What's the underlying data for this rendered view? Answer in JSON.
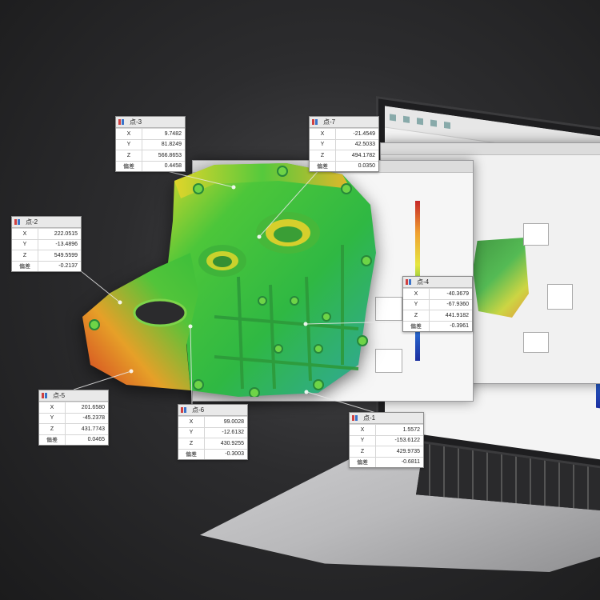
{
  "points": [
    {
      "name": "点-1",
      "x": "1.5572",
      "y": "-153.6122",
      "z": "429.9735",
      "dev": "-0.6811"
    },
    {
      "name": "点-2",
      "x": "222.0515",
      "y": "-13.4896",
      "z": "549.5599",
      "dev": "-0.2137"
    },
    {
      "name": "点-3",
      "x": "9.7482",
      "y": "81.8249",
      "z": "566.8653",
      "dev": "0.4458"
    },
    {
      "name": "点-4",
      "x": "-40.3679",
      "y": "-67.9360",
      "z": "441.9182",
      "dev": "-0.3961"
    },
    {
      "name": "点-5",
      "x": "201.6580",
      "y": "-45.2378",
      "z": "431.7743",
      "dev": "0.0465"
    },
    {
      "name": "点-6",
      "x": "99.0028",
      "y": "-12.6132",
      "z": "430.9255",
      "dev": "-0.3003"
    },
    {
      "name": "点-7",
      "x": "-21.4549",
      "y": "42.5033",
      "z": "494.1782",
      "dev": "0.0350"
    }
  ],
  "labels": {
    "x": "X",
    "y": "Y",
    "z": "Z",
    "dev": "偏差"
  },
  "colors": {
    "deviation_high": "#e23a1c",
    "deviation_mid": "#e8e23a",
    "deviation_zero": "#3cc43c",
    "deviation_low": "#1f52c7"
  }
}
